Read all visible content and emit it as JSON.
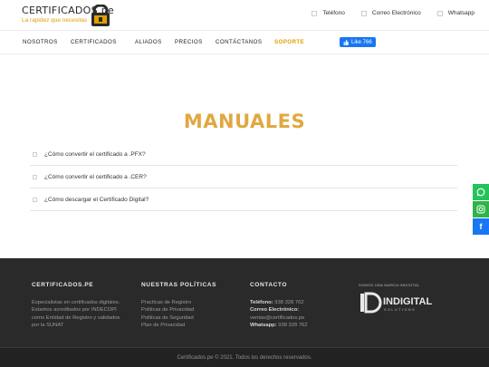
{
  "brand": {
    "name": "CERTIFICADOS.pe",
    "tagline": "La rapidez que necesitas"
  },
  "contacts": [
    {
      "label": "Teléfono",
      "icon": "phone-icon"
    },
    {
      "label": "Correo Electrónico",
      "icon": "mail-icon"
    },
    {
      "label": "Whatsapp",
      "icon": "whatsapp-icon"
    }
  ],
  "nav": {
    "items": [
      "NOSOTROS",
      "CERTIFICADOS",
      "ALIADOS",
      "PRECIOS",
      "CONTÁCTANOS",
      "SOPORTE"
    ],
    "active": "SOPORTE",
    "like_label": "Like 766"
  },
  "main": {
    "title": "MANUALES",
    "faq": [
      "¿Cómo convertir el certificado a .PFX?",
      "¿Cómo convertir el certificado a .CER?",
      "¿Cómo descargar el Certificado Digital?"
    ]
  },
  "footer": {
    "about": {
      "title": "CERTIFICADOS.PE",
      "lines": [
        "Especialistas en certificados digitales.",
        "Estamos acreditados por INDECOPI",
        "como Entidad de Registro y validados",
        "por la SUNAT"
      ]
    },
    "policies": {
      "title": "NUESTRAS POLÍTICAS",
      "links": [
        "Practicas de Registro",
        "Politicas de Privacidad",
        "Politicas de Seguridad",
        "Plan de Privacidad"
      ]
    },
    "contact": {
      "title": "CONTACTO",
      "phone_label": "Teléfono:",
      "phone": "938 328 762",
      "email_label": "Correo Electrónico:",
      "email": "ventas@certificados.pe",
      "whatsapp_label": "Whatsapp:",
      "whatsapp": "938 328 762"
    },
    "brand": {
      "heading": "SOMOS UNA MARCA INDIGITAL",
      "logo_text": "INDIGITAL",
      "logo_sub": "SOLUTIONS",
      "logo_mark": "ID"
    },
    "copyright": "Certificados.pe © 2021. Todos los derechos reservados."
  },
  "colors": {
    "accent": "#e0a840",
    "footer_bg": "#2a2a2a",
    "facebook": "#1877f2",
    "whatsapp": "#25c35a"
  }
}
